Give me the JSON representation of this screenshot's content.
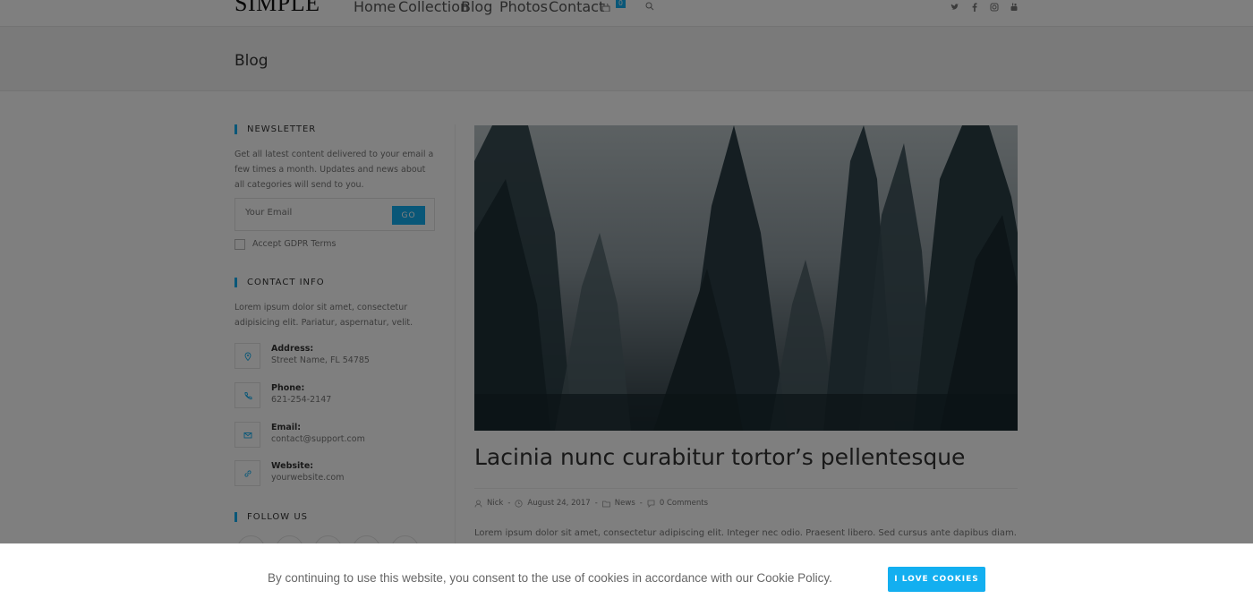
{
  "header": {
    "logo": "SIMPLE",
    "nav": [
      {
        "label": "Home"
      },
      {
        "label": "Collection"
      },
      {
        "label": "Blog"
      },
      {
        "label": "Photos"
      },
      {
        "label": "Contact"
      }
    ],
    "cart_count": "0",
    "social_icons": [
      "twitter-icon",
      "facebook-icon",
      "instagram-icon",
      "youtube-icon"
    ]
  },
  "page": {
    "title": "Blog"
  },
  "sidebar": {
    "newsletter": {
      "title": "NEWSLETTER",
      "description": "Get all latest content delivered to your email a few times a month. Updates and news about all categories will send to you.",
      "email_placeholder": "Your Email",
      "button_label": "GO",
      "gdpr_label": "Accept GDPR Terms"
    },
    "contact": {
      "title": "CONTACT INFO",
      "description": "Lorem ipsum dolor sit amet, consectetur adipisicing elit. Pariatur, aspernatur, velit.",
      "items": [
        {
          "label": "Address:",
          "value": "Street Name, FL 54785",
          "icon": "location-icon"
        },
        {
          "label": "Phone:",
          "value": "621-254-2147",
          "icon": "phone-icon"
        },
        {
          "label": "Email:",
          "value": "contact@support.com",
          "icon": "email-icon"
        },
        {
          "label": "Website:",
          "value": "yourwebsite.com",
          "icon": "link-icon"
        }
      ]
    },
    "follow": {
      "title": "FOLLOW US"
    }
  },
  "post": {
    "title": "Lacinia nunc curabitur tortor’s pellentesque",
    "author": "Nick",
    "date": "August 24, 2017",
    "category": "News",
    "comments": "0 Comments",
    "excerpt": "Lorem ipsum dolor sit amet, consectetur adipiscing elit. Integer nec odio. Praesent libero. Sed cursus ante dapibus diam. Sed"
  },
  "cookie": {
    "text": "By continuing to use this website, you consent to the use of cookies in accordance with our Cookie Policy.",
    "button_label": "I LOVE COOKIES"
  },
  "colors": {
    "accent": "#13aff0",
    "overlay": "rgba(0,0,0,0.5)"
  }
}
